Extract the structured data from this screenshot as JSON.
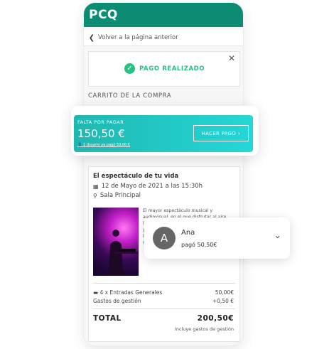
{
  "app": {
    "logo_text": "PCQ"
  },
  "nav": {
    "back_label": "Volver a la página anterior"
  },
  "payment_status": {
    "label": "PAGO REALIZADO",
    "close_icon": "close-icon",
    "status_color": "#27c283"
  },
  "cart": {
    "section_label": "CARRITO DE LA COMPRA"
  },
  "pending": {
    "label": "FALTA POR PAGAR",
    "amount": "150,50 €",
    "note": "1 Usuario ya pagó 50,00 €",
    "button_label": "HACER PAGO"
  },
  "event": {
    "title": "El espectáculo de tu vida",
    "date": "12 de Mayo de 2021 a las 15:30h",
    "venue": "Sala Principal",
    "description": "El mayor espectáculo musical y audiovisual, en el que disfrutar al aire libre de los mejores artistas. Su historia y sus artistas hacen de este entorno un lugar único para disfrutar de la mejor música en directo."
  },
  "order": {
    "items": [
      {
        "label": "4 x Entradas Generales",
        "value": "50,00€"
      },
      {
        "label": "Gastos de gestión",
        "value": "+0,50 €"
      }
    ],
    "total_label": "TOTAL",
    "total_value": "200,50€",
    "total_note": "Incluye gastos de gestión"
  },
  "notification": {
    "avatar_initial": "A",
    "name": "Ana",
    "message": "pagó 50,50€"
  },
  "colors": {
    "brand": "#0c8c72",
    "accent_start": "#1fb8b0",
    "accent_end": "#25d7d8"
  }
}
